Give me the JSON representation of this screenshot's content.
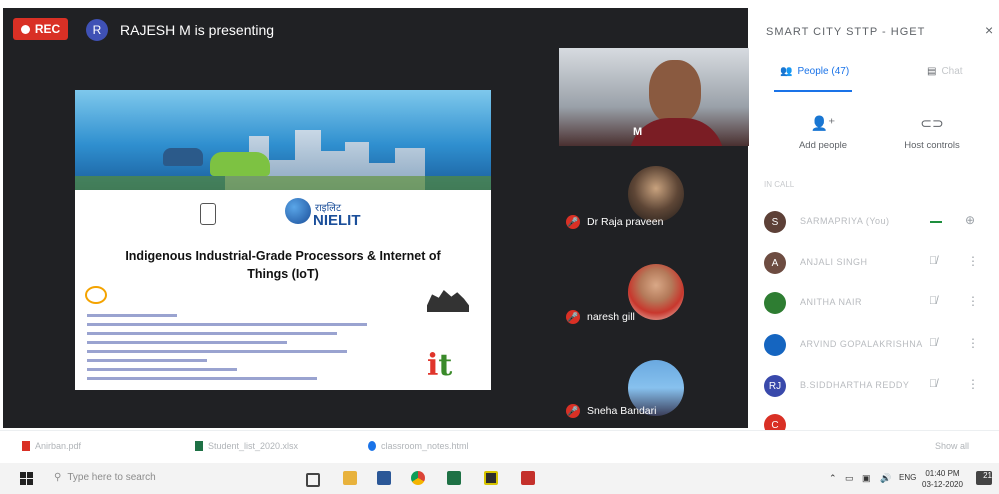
{
  "meeting": {
    "rec_label": "REC",
    "presenter_initial": "R",
    "presenter_text": "RAJESH M is presenting"
  },
  "slide": {
    "org_hindi": "राइलिट",
    "org_name": "NIELIT",
    "title_line1": "Indigenous Industrial-Grade Processors &  Internet of",
    "title_line2": "Things (IoT)",
    "logo_i": "i",
    "logo_t": "t"
  },
  "tiles": [
    {
      "initial": "M",
      "name": ""
    },
    {
      "name": "Dr Raja praveen"
    },
    {
      "name": "naresh gill"
    },
    {
      "name": "Sneha Bandari"
    }
  ],
  "panel": {
    "title": "SMART CITY STTP - HGET",
    "close": "×",
    "tab_people": "People (47)",
    "tab_chat": "Chat",
    "add_people": "Add people",
    "host_controls": "Host controls",
    "section": "IN CALL",
    "participants": [
      {
        "initial": "S",
        "color": "#5d4037",
        "name": "SARMAPRIYA (You)"
      },
      {
        "initial": "A",
        "color": "#6d4c41",
        "name": "ANJALI SINGH"
      },
      {
        "initial": "",
        "color": "#2e7d32",
        "name": "ANITHA NAIR"
      },
      {
        "initial": "",
        "color": "#1565c0",
        "name": "ARVIND GOPALAKRISHNA"
      },
      {
        "initial": "RJ",
        "color": "#3949ab",
        "name": "B.SIDDHARTHA REDDY"
      },
      {
        "initial": "C",
        "color": "#d93025",
        "name": ""
      }
    ]
  },
  "downloads": {
    "items": [
      "Anirban.pdf",
      "Student_list_2020.xlsx",
      "classroom_notes.html"
    ],
    "show_all": "Show all"
  },
  "taskbar": {
    "search_placeholder": "Type here to search",
    "lang": "ENG",
    "time": "01:40 PM",
    "date": "03-12-2020",
    "notif_count": "21"
  }
}
